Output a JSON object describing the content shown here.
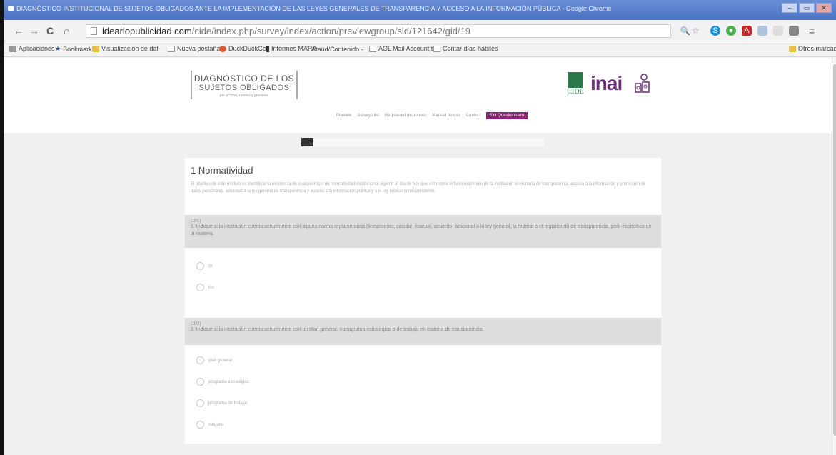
{
  "window": {
    "title": "DIAGNÓSTICO INSTITUCIONAL DE SUJETOS OBLIGADOS ANTE LA IMPLEMENTACIÓN DE LAS LEYES GENERALES DE TRANSPARENCIA Y ACCESO A LA INFORMACIÓN PÚBLICA - Google Chrome"
  },
  "browser": {
    "url_host": "ideariopublicidad.com",
    "url_path": "/cide/index.php/survey/index/action/previewgroup/sid/121642/gid/19"
  },
  "bookmarks": [
    {
      "label": "Aplicaciones"
    },
    {
      "label": "Bookmarks"
    },
    {
      "label": "Visualización de dat"
    },
    {
      "label": "Nueva pestaña"
    },
    {
      "label": "DuckDuckGo"
    },
    {
      "label": "Informes MARA"
    },
    {
      "label": "Ataúd/Contenido -"
    },
    {
      "label": "AOL Mail Account to"
    },
    {
      "label": "Contar días hábiles"
    },
    {
      "label": "Otros marcadores"
    }
  ],
  "site": {
    "logo_line1": "DIAGNÓSTICO DE LOS",
    "logo_line2": "SUJETOS OBLIGADOS",
    "logo_line3": "por acceso, rastreo y procesos",
    "cide_label": "CIDE",
    "inai_label": "inai",
    "nav": [
      "Preview",
      "Surveys list",
      "Registered responses",
      "Manual de uso",
      "Contact",
      "Exit Questionnaire"
    ]
  },
  "survey": {
    "progress_fraction": 0.05,
    "group_title": "1 Normatividad",
    "group_description": "El objetivo de este módulo es identificar la existencia de cualquier tipo de normatividad institucional vigente al día de hoy que estructure el funcionamiento de la institución en materia de transparencia, acceso a la información y protección de datos personales, adicional a la ley general de transparencia y acceso a la información pública y a la ley federal correspondiente.",
    "questions": [
      {
        "code": "[1P1]",
        "text": "1. Indique si la institución cuenta actualmente con alguna norma reglamentaria (lineamiento, circular, manual, acuerdo) adicional a la ley general, la federal o el reglamento de transparencia, pero específica en la materia.",
        "options": [
          "Sí",
          "No"
        ]
      },
      {
        "code": "[1P2]",
        "text": "2. Indique si la institución cuenta actualmente con un plan general, o programa estratégico o de trabajo en materia de transparencia.",
        "options": [
          "plan general",
          "programa estratégico",
          "programa de trabajo",
          "ninguno"
        ]
      }
    ]
  }
}
